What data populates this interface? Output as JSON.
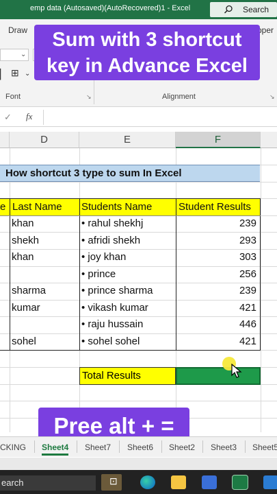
{
  "window": {
    "title": "emp data (Autosaved)(AutoRecovered)1  -  Excel",
    "search_label": "Search"
  },
  "ribbon": {
    "tab_draw": "Draw",
    "tab_partial": "pper",
    "group_font": "Font",
    "group_alignment": "Alignment"
  },
  "overlay": {
    "top_text": "Sum with 3 shortcut key in Advance Excel",
    "bottom_text": "Pree alt + ="
  },
  "formula_bar": {
    "fx": "fx",
    "value": ""
  },
  "columns": [
    "D",
    "E",
    "F"
  ],
  "sheet": {
    "header_title": "How shortcut 3 type to sum In Excel",
    "table_headers": {
      "col_c_partial": "e",
      "last_name": "Last Name",
      "students_name": "Students Name",
      "student_results": "Student Results"
    },
    "rows": [
      {
        "last_name": "khan",
        "student": "• rahul shekhj",
        "result": "239"
      },
      {
        "last_name": "shekh",
        "student": "• afridi shekh",
        "result": "293"
      },
      {
        "last_name": "khan",
        "student": "• joy khan",
        "result": "303"
      },
      {
        "last_name": "",
        "student": "• prince",
        "result": "256"
      },
      {
        "last_name": "sharma",
        "student": "• prince sharma",
        "result": "239"
      },
      {
        "last_name": "kumar",
        "student": "• vikash kumar",
        "result": "421"
      },
      {
        "last_name": "",
        "student": "• raju hussain",
        "result": "446"
      },
      {
        "last_name": "sohel",
        "student": "• sohel sohel",
        "result": "421"
      }
    ],
    "total_label": "Total Results"
  },
  "sheet_tabs": [
    "CKING",
    "Sheet4",
    "Sheet7",
    "Sheet6",
    "Sheet2",
    "Sheet3",
    "Sheet5"
  ],
  "active_sheet": "Sheet4",
  "taskbar": {
    "search_partial": "earch"
  },
  "colors": {
    "excel_green": "#217346",
    "banner_purple": "#7a3fe0",
    "header_blue": "#bdd7ee",
    "highlight_yellow": "#ffff00",
    "selected_green": "#1e9a4a"
  }
}
